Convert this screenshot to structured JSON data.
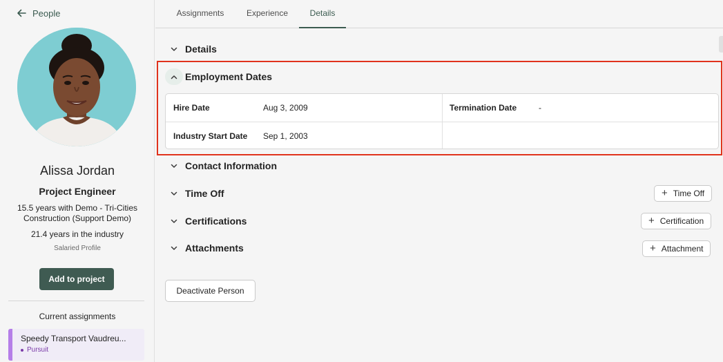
{
  "sidebar": {
    "back_label": "People",
    "person": {
      "name": "Alissa Jordan",
      "title": "Project Engineer",
      "tenure": "15.5 years with Demo - Tri-Cities Construction (Support Demo)",
      "industry": "21.4 years in the industry",
      "profile_type": "Salaried Profile"
    },
    "add_button": "Add to project",
    "assignments_heading": "Current assignments",
    "assignment": {
      "name": "Speedy Transport Vaudreu...",
      "status": "Pursuit"
    }
  },
  "tabs": [
    {
      "label": "Assignments",
      "active": false
    },
    {
      "label": "Experience",
      "active": false
    },
    {
      "label": "Details",
      "active": true
    }
  ],
  "sections": {
    "details": "Details",
    "employment": "Employment Dates",
    "contact": "Contact Information",
    "time_off": "Time Off",
    "certifications": "Certifications",
    "attachments": "Attachments"
  },
  "employment_dates": {
    "hire_label": "Hire Date",
    "hire_value": "Aug 3, 2009",
    "termination_label": "Termination Date",
    "termination_value": "-",
    "industry_label": "Industry Start Date",
    "industry_value": "Sep 1, 2003"
  },
  "actions": {
    "time_off": "Time Off",
    "certification": "Certification",
    "attachment": "Attachment",
    "deactivate": "Deactivate Person"
  },
  "colors": {
    "brand": "#3f5b52",
    "highlight": "#e0321c",
    "assignment_accent": "#b57ee8"
  },
  "icons": {
    "back": "arrow-left-icon",
    "collapsed": "chevron-down-icon",
    "expanded": "chevron-up-icon",
    "add": "plus-icon"
  }
}
